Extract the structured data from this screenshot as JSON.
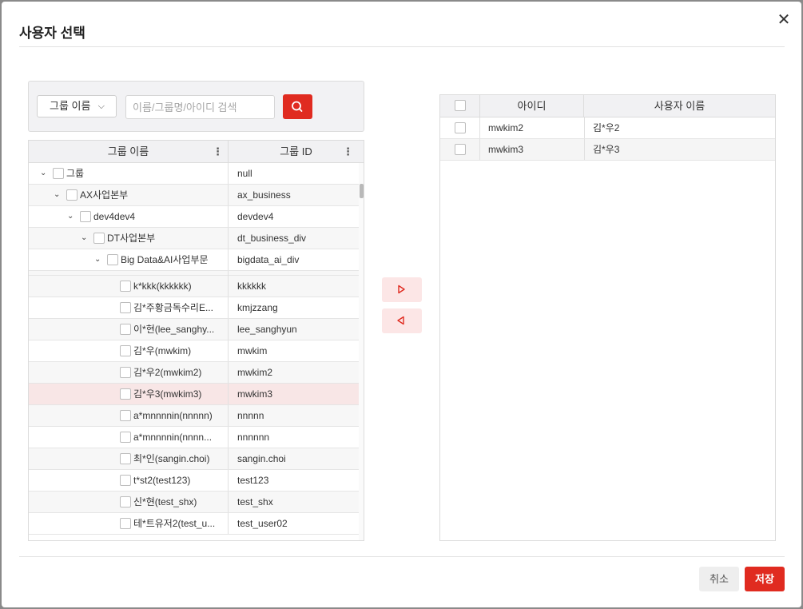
{
  "dialog": {
    "title": "사용자 선택"
  },
  "search": {
    "group_select_label": "그룹 이름",
    "placeholder": "이름/그룹명/아이디 검색"
  },
  "left_grid": {
    "col_name": "그룹 이름",
    "col_id": "그룹 ID",
    "rows": [
      {
        "label": "그룹",
        "id": "null"
      },
      {
        "label": "AX사업본부",
        "id": "ax_business"
      },
      {
        "label": "dev4dev4",
        "id": "devdev4"
      },
      {
        "label": "DT사업본부",
        "id": "dt_business_div"
      },
      {
        "label": "Big Data&AI사업부문",
        "id": "bigdata_ai_div"
      },
      {
        "label": "k*kkk(kkkkkk)",
        "id": "kkkkkk"
      },
      {
        "label": "김*주황금독수리E...",
        "id": "kmjzzang"
      },
      {
        "label": "이*현(lee_sanghy...",
        "id": "lee_sanghyun"
      },
      {
        "label": "김*우(mwkim)",
        "id": "mwkim"
      },
      {
        "label": "김*우2(mwkim2)",
        "id": "mwkim2"
      },
      {
        "label": "김*우3(mwkim3)",
        "id": "mwkim3"
      },
      {
        "label": "a*mnnnnin(nnnnn)",
        "id": "nnnnn"
      },
      {
        "label": "a*mnnnnin(nnnn...",
        "id": "nnnnnn"
      },
      {
        "label": "최*인(sangin.choi)",
        "id": "sangin.choi"
      },
      {
        "label": "t*st2(test123)",
        "id": "test123"
      },
      {
        "label": "신*현(test_shx)",
        "id": "test_shx"
      },
      {
        "label": "테*트유저2(test_u...",
        "id": "test_user02"
      }
    ]
  },
  "right_grid": {
    "col_id": "아이디",
    "col_name": "사용자 이름",
    "rows": [
      {
        "id": "mwkim2",
        "name": "김*우2"
      },
      {
        "id": "mwkim3",
        "name": "김*우3"
      }
    ]
  },
  "footer": {
    "cancel_label": "취소",
    "save_label": "저장"
  },
  "colors": {
    "accent": "#e02b20",
    "selected_row": "#f8e6e6",
    "move_button_bg": "#fce6e6"
  }
}
